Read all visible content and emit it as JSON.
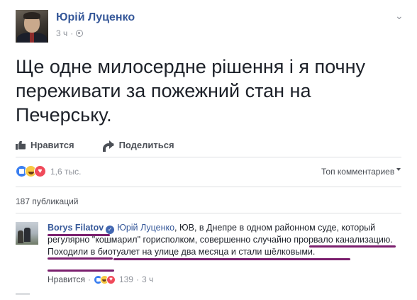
{
  "post": {
    "author": "Юрій Луценко",
    "time": "3 ч",
    "meta_sep": "·",
    "text": "Ще одне милосердне рішення і я почну переживати за пожежний стан на Печерську."
  },
  "actions": {
    "like_label": "Нравится",
    "share_label": "Поделиться"
  },
  "reactions": {
    "count": "1,6 тыс.",
    "top_comments_label": "Топ комментариев",
    "icons": [
      "like-icon",
      "haha-icon",
      "love-icon"
    ]
  },
  "shares": {
    "label": "187 публикаций"
  },
  "comment": {
    "author": "Borys Filatov",
    "mention": "Юрій Луценко",
    "text": ", ЮВ, в Днепре в одном районном суде, который регулярно \"кошмарил\" горисполком, совершенно случайно прорвало канализацию. Походили в биотуалет на улице два месяца и стали шёлковыми.",
    "like_label": "Нравится",
    "sep": "·",
    "reaction_count": "139",
    "time": "3 ч"
  },
  "colors": {
    "link_blue": "#365899",
    "underline_purple": "#7b1f6e",
    "meta_gray": "#90949c"
  }
}
